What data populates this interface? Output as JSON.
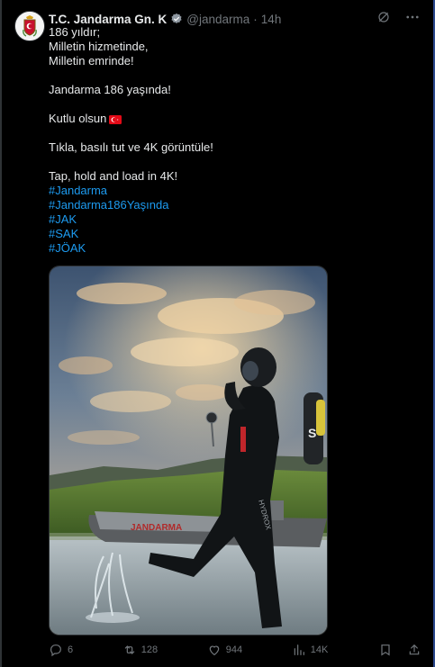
{
  "tweet": {
    "author_name": "T.C. Jandarma Gn. K",
    "handle": "@jandarma",
    "separator": "·",
    "time": "14h",
    "text_lines": [
      "186 yıldır;",
      "Milletin hizmetinde,",
      "Milletin emrinde!",
      "",
      "Jandarma 186 yaşında!",
      "",
      "Kutlu olsun",
      "",
      "Tıkla, basılı tut ve 4K görüntüle!",
      "",
      "Tap, hold and load in 4K!"
    ],
    "hashtags": [
      "#Jandarma",
      "#Jandarma186Yaşında",
      "#JAK",
      "#SAK",
      "#JÖAK"
    ],
    "boat_text": "JANDARMA",
    "suit_text": "HYDROX",
    "tank_text": "S"
  },
  "metrics": {
    "replies": "6",
    "reposts": "128",
    "likes": "944",
    "views": "14K"
  },
  "icons": {
    "verified": "verified-badge-icon",
    "grok": "grok-icon",
    "more": "more-icon",
    "reply": "reply-icon",
    "repost": "repost-icon",
    "like": "like-icon",
    "views": "views-icon",
    "bookmark": "bookmark-icon",
    "share": "share-icon",
    "flag": "turkey-flag-icon"
  },
  "colors": {
    "background": "#000000",
    "text": "#e7e9ea",
    "muted": "#71767b",
    "link": "#1d9bf0",
    "flag_red": "#e30a17"
  }
}
